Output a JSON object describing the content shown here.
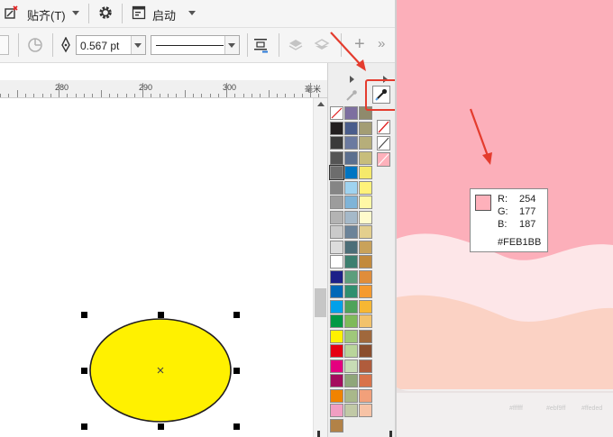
{
  "toolbar1": {
    "snap_label": "贴齐(T)",
    "start_label": "启动",
    "icons": [
      "snap-icon",
      "gear-icon",
      "launch-icon"
    ]
  },
  "toolbar2": {
    "outline_width": "0.567 pt",
    "icons": [
      "pen-nib-icon",
      "text-wrap-icon",
      "layer-forward-icon",
      "layer-back-icon",
      "add-icon",
      "more-icon"
    ]
  },
  "ruler": {
    "labels": [
      "280",
      "290",
      "300"
    ],
    "unit": "毫米"
  },
  "palette": {
    "columns": [
      [
        "#231f20",
        "#3a3a3a",
        "#555555",
        "#6d6d6d",
        "#858585",
        "#9c9c9c",
        "#b3b3b3",
        "#cacaca",
        "#dcdcdc",
        "#ffffff",
        "#1d2088",
        "#0068b7",
        "#00a0e9",
        "#009944",
        "#fff100",
        "#e60012",
        "#e4007f",
        "#a40b5d",
        "#f08300",
        "#f19ec2",
        "#b28247"
      ],
      [
        "#7d6fa0",
        "#4a5d8c",
        "#6b7aa0",
        "#5b6f8f",
        "#0075c2",
        "#9fd3f0",
        "#7fb4d8",
        "#a5b9c9",
        "#6b8399",
        "#4c6e78",
        "#3c7f6f",
        "#5c9e7c",
        "#2f8f6f",
        "#4fa35a",
        "#7fba5a",
        "#9fc87a",
        "#b9d59b",
        "#c7dcb5",
        "#8fa67a",
        "#a9b88a",
        "#c1c9a6"
      ],
      [
        "#8f8a6c",
        "#a39d74",
        "#b6ae7a",
        "#c7bd7c",
        "#f5e96b",
        "#fff27a",
        "#fff8a6",
        "#fffbcc",
        "#e3cf8e",
        "#c9a25a",
        "#c28a3c",
        "#e08d3a",
        "#f59a2e",
        "#f7b733",
        "#f2c26b",
        "#a0683c",
        "#8a4e2e",
        "#b05c3c",
        "#d9734a",
        "#f2a07a",
        "#f7c3a6"
      ]
    ]
  },
  "docker": {
    "icons": [
      "expand-arrow-icon",
      "eyedropper-icon",
      "no-fill-icon",
      "no-outline-icon",
      "fill-color-icon"
    ]
  },
  "color_tooltip": {
    "r_label": "R:",
    "r_value": "254",
    "g_label": "G:",
    "g_value": "177",
    "b_label": "B:",
    "b_value": "187",
    "hex": "#FEB1BB",
    "swatch_color": "#FEB1BB"
  },
  "right_pane": {
    "background": "#FCAFBA",
    "bottom_labels": [
      "#ffffff",
      "#ebf9ff",
      "#ffeded"
    ]
  },
  "shape": {
    "fill": "#FFF100",
    "outline": "#231F20"
  }
}
